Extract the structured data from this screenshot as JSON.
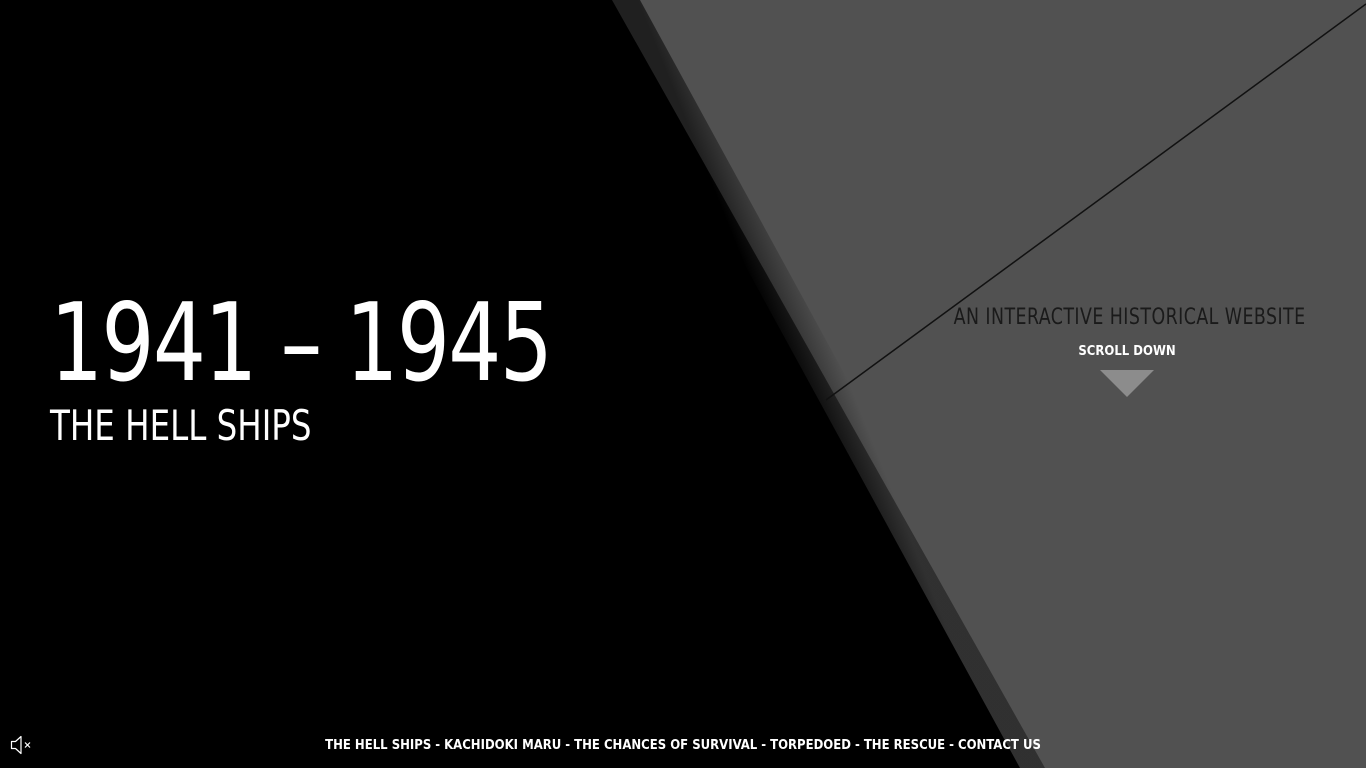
{
  "hero": {
    "years": "1941 – 1945",
    "subtitle": "THE HELL SHIPS"
  },
  "right_panel": {
    "tagline": "AN INTERACTIVE HISTORICAL WEBSITE",
    "scroll_label": "SCROLL DOWN"
  },
  "footer_nav": {
    "items": [
      "THE HELL SHIPS",
      "KACHIDOKI MARU",
      "THE CHANCES OF SURVIVAL",
      "TORPEDOED",
      "THE RESCUE",
      "CONTACT US"
    ],
    "separator": "-"
  },
  "icons": {
    "mute": "speaker-muted-icon",
    "scroll": "triangle-down-icon"
  },
  "colors": {
    "left_background": "#000000",
    "right_background": "#515151",
    "diagonal_line": "#111111",
    "text_primary": "#ffffff",
    "tagline_text": "#1a1a1a",
    "arrow": "#8c8c8c"
  }
}
